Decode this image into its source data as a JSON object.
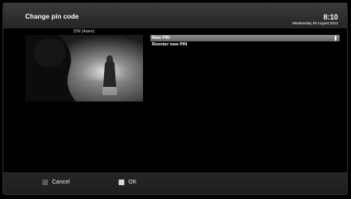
{
  "header": {
    "title": "Change pin code",
    "time": "8:10",
    "date": "Wednesday 29 August 2012"
  },
  "preview": {
    "channel": "DW (Asien)"
  },
  "menu": {
    "items": [
      {
        "label": "New PIN",
        "selected": true
      },
      {
        "label": "Reenter new PIN",
        "selected": false
      }
    ]
  },
  "footer": {
    "cancel_label": "Cancel",
    "ok_label": "OK",
    "cancel_color": "#5a5a5a",
    "ok_color": "#d8d8d8"
  }
}
